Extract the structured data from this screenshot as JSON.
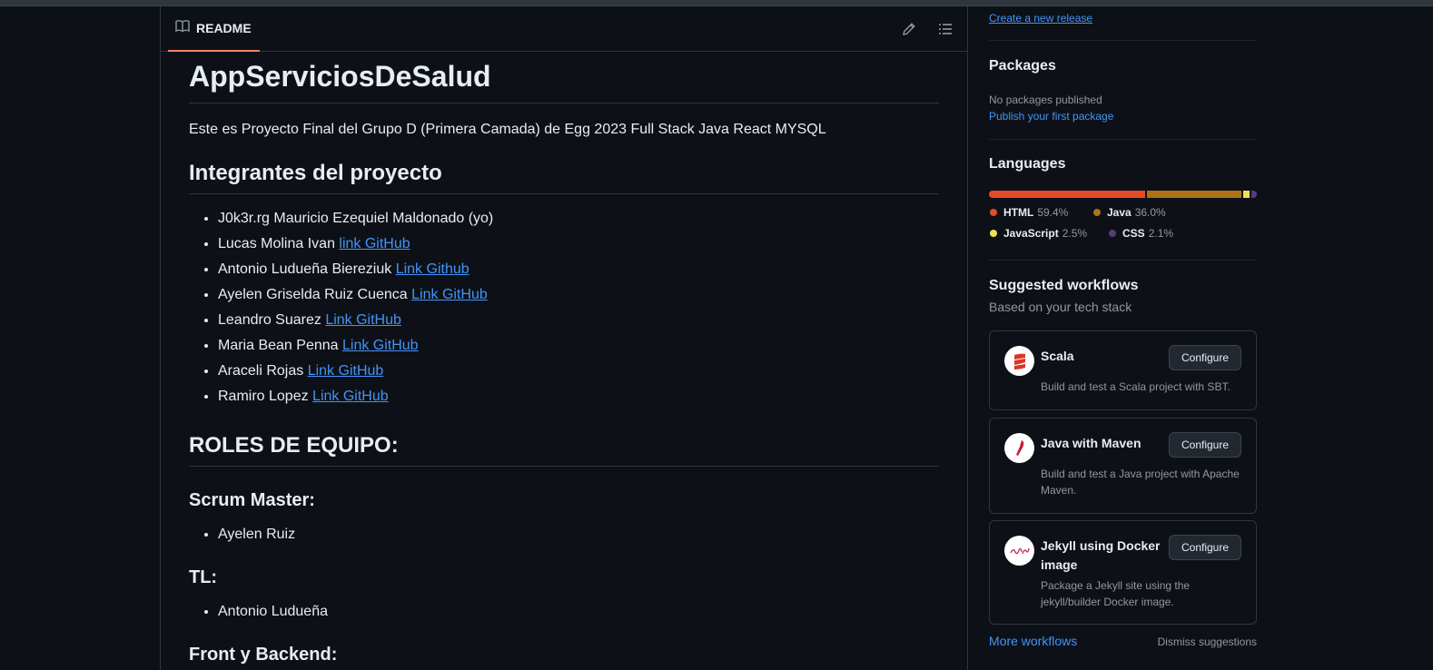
{
  "readme": {
    "tab_label": "README",
    "title": "AppServiciosDeSalud",
    "description": "Este es Proyecto Final del Grupo D (Primera Camada) de Egg 2023 Full Stack Java React MYSQL",
    "members_heading": "Integrantes del proyecto",
    "members": [
      {
        "name": "J0k3r.rg Mauricio Ezequiel Maldonado (yo)",
        "link": ""
      },
      {
        "name": "Lucas Molina Ivan ",
        "link": "link GitHub"
      },
      {
        "name": "Antonio Ludueña Biereziuk ",
        "link": "Link Github"
      },
      {
        "name": "Ayelen Griselda Ruiz Cuenca ",
        "link": "Link GitHub"
      },
      {
        "name": "Leandro Suarez ",
        "link": "Link GitHub"
      },
      {
        "name": "Maria Bean Penna ",
        "link": "Link GitHub"
      },
      {
        "name": "Araceli Rojas ",
        "link": "Link GitHub"
      },
      {
        "name": "Ramiro Lopez ",
        "link": "Link GitHub"
      }
    ],
    "roles_heading": "ROLES DE EQUIPO:",
    "scrum_heading": "Scrum Master:",
    "scrum_member": "Ayelen Ruiz",
    "tl_heading": "TL:",
    "tl_member": "Antonio Ludueña",
    "front_heading": "Front y Backend:"
  },
  "sidebar": {
    "release_link": "Create a new release",
    "packages_title": "Packages",
    "packages_empty": "No packages published",
    "packages_link": "Publish your first package",
    "languages_title": "Languages",
    "languages": [
      {
        "name": "HTML",
        "percent": "59.4%",
        "value": 59.4,
        "color": "#e34c26"
      },
      {
        "name": "Java",
        "percent": "36.0%",
        "value": 36.0,
        "color": "#b07219"
      },
      {
        "name": "JavaScript",
        "percent": "2.5%",
        "value": 2.5,
        "color": "#f1e05a"
      },
      {
        "name": "CSS",
        "percent": "2.1%",
        "value": 2.1,
        "color": "#563d7c"
      }
    ],
    "workflows_title": "Suggested workflows",
    "workflows_subtitle": "Based on your tech stack",
    "workflows": [
      {
        "name": "Scala",
        "description": "Build and test a Scala project with SBT.",
        "button": "Configure",
        "icon": "scala-icon"
      },
      {
        "name": "Java with Maven",
        "description": "Build and test a Java project with Apache Maven.",
        "button": "Configure",
        "icon": "maven-icon"
      },
      {
        "name": "Jekyll using Docker image",
        "description": "Package a Jekyll site using the jekyll/builder Docker image.",
        "button": "Configure",
        "icon": "jekyll-icon"
      }
    ],
    "more_workflows": "More workflows",
    "dismiss": "Dismiss suggestions"
  }
}
